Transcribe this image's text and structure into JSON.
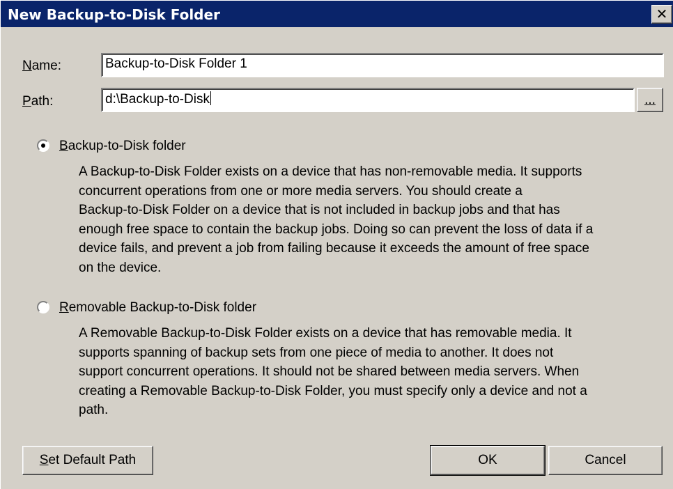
{
  "window": {
    "title": "New Backup-to-Disk Folder",
    "close_glyph": "✕"
  },
  "form": {
    "name_label_key": "N",
    "name_label_rest": "ame:",
    "name_value": "Backup-to-Disk Folder 1",
    "path_label_key": "P",
    "path_label_rest": "ath:",
    "path_value": "d:\\Backup-to-Disk",
    "browse_label": "..."
  },
  "options": {
    "backup_to_disk": {
      "key": "B",
      "rest": "ackup-to-Disk folder",
      "selected": true,
      "description_lines": [
        "A Backup-to-Disk Folder exists on a device that has non-removable media.  It supports",
        "concurrent operations from one or more media servers.  You should create a",
        "Backup-to-Disk Folder on a device that is not included in backup jobs and that has",
        "enough free space to contain the backup jobs.  Doing so can prevent the loss of data if a",
        "device fails, and prevent a job from failing because it exceeds the amount of free space",
        "on the device."
      ]
    },
    "removable": {
      "key": "R",
      "rest": "emovable Backup-to-Disk folder",
      "selected": false,
      "description_lines": [
        "A Removable Backup-to-Disk Folder exists on a device that has removable media.  It",
        "supports spanning of backup sets from one piece of media to another.  It does not",
        "support concurrent operations.  It should not be shared between media servers.  When",
        "creating a Removable Backup-to-Disk Folder, you must specify only a device and not a",
        "path."
      ]
    }
  },
  "buttons": {
    "set_default_key": "S",
    "set_default_rest": "et Default Path",
    "ok": "OK",
    "cancel": "Cancel"
  }
}
